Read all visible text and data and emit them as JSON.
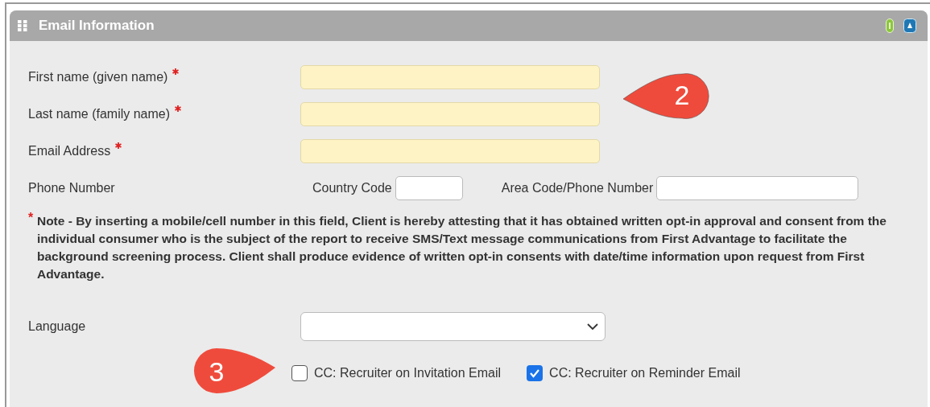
{
  "panel": {
    "title": "Email Information"
  },
  "fields": [
    {
      "label": "First name (given name)",
      "required": true
    },
    {
      "label": "Last name (family name)",
      "required": true
    },
    {
      "label": "Email Address",
      "required": true
    }
  ],
  "phone": {
    "label": "Phone Number",
    "country_code_label": "Country Code",
    "number_label": "Area Code/Phone Number"
  },
  "note": {
    "marker": "*",
    "text": "Note - By inserting a mobile/cell number in this field, Client is hereby attesting that it has obtained written opt-in approval and consent from the individual consumer who is the subject of the report to receive SMS/Text message communications from First Advantage to facilitate the background screening process. Client shall produce evidence of written opt-in consents with date/time information upon request from First Advantage."
  },
  "language": {
    "label": "Language"
  },
  "checkboxes": [
    {
      "label": "CC: Recruiter on Invitation Email",
      "checked": false
    },
    {
      "label": "CC: Recruiter on Reminder Email",
      "checked": true
    }
  ],
  "callouts": [
    {
      "text": "2",
      "kind": "leftpointer"
    },
    {
      "text": "3",
      "kind": "rightpointer"
    }
  ]
}
